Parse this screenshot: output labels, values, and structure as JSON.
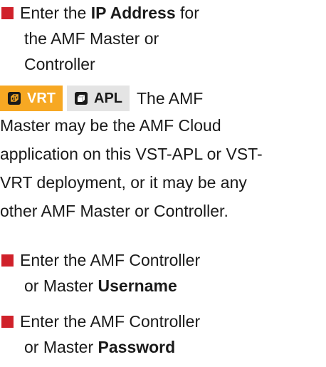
{
  "steps": [
    {
      "lines": [
        {
          "pre": "Enter the ",
          "bold": "IP Address",
          "post": " for"
        },
        {
          "text": "the AMF Master or"
        },
        {
          "text": "Controller"
        }
      ]
    },
    {
      "lines": [
        {
          "text": "Enter the AMF Controller"
        },
        {
          "pre": "or Master ",
          "bold": "Username"
        }
      ]
    },
    {
      "lines": [
        {
          "text": "Enter the AMF Controller"
        },
        {
          "pre": "or Master ",
          "bold": "Password"
        }
      ]
    }
  ],
  "badges": {
    "vrt": {
      "label": "VRT",
      "icon": "cube-wireframe-icon",
      "color": "#f7a823"
    },
    "apl": {
      "label": "APL",
      "icon": "appliance-box-icon",
      "color": "#e4e4e4"
    }
  },
  "note": {
    "lead": "The AMF",
    "lines": [
      "Master may be the AMF Cloud",
      "application on this VST-APL or VST-",
      "VRT deployment, or it may be any",
      "other AMF Master or Controller."
    ]
  },
  "colors": {
    "bullet": "#d0212a",
    "text": "#1a1a1a"
  }
}
